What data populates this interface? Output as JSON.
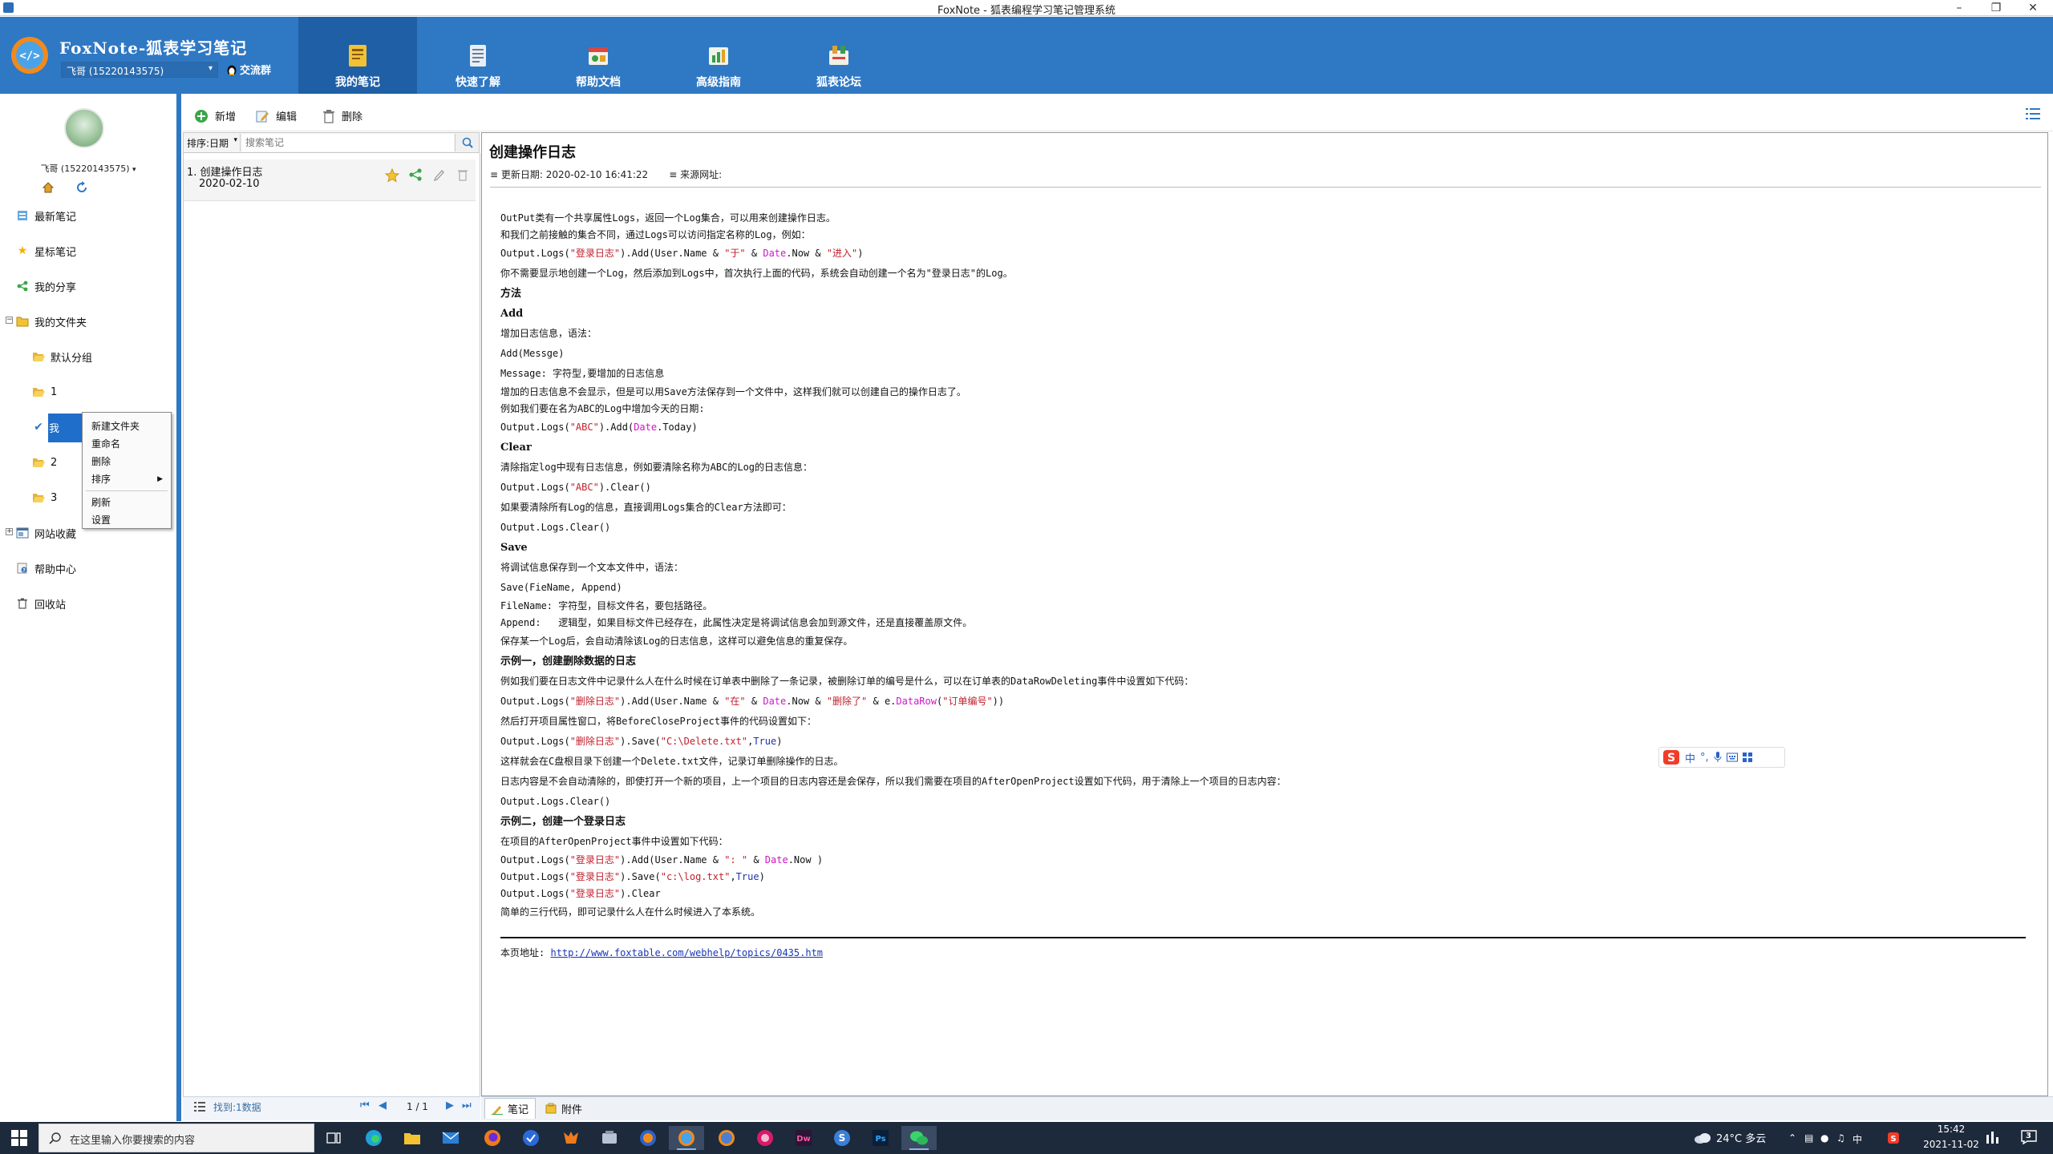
{
  "window": {
    "title": "FoxNote - 狐表编程学习笔记管理系统"
  },
  "header": {
    "app_title": "FoxNote-狐表学习笔记",
    "user": "飞哥 (15220143575)",
    "chat_group": "交流群",
    "tabs": [
      {
        "label": "我的笔记"
      },
      {
        "label": "快速了解"
      },
      {
        "label": "帮助文档"
      },
      {
        "label": "高级指南"
      },
      {
        "label": "狐表论坛"
      }
    ]
  },
  "sidebar": {
    "user_label": "飞哥 (15220143575)",
    "items": [
      {
        "label": "最新笔记"
      },
      {
        "label": "星标笔记"
      },
      {
        "label": "我的分享"
      },
      {
        "label": "我的文件夹"
      },
      {
        "label": "默认分组"
      },
      {
        "label": "1"
      },
      {
        "label": "我"
      },
      {
        "label": "2"
      },
      {
        "label": "3"
      },
      {
        "label": "网站收藏"
      },
      {
        "label": "帮助中心"
      },
      {
        "label": "回收站"
      }
    ]
  },
  "context_menu": {
    "items": [
      "新建文件夹",
      "重命名",
      "删除",
      "排序",
      "刷新",
      "设置"
    ]
  },
  "toolbar": {
    "new": "新增",
    "edit": "编辑",
    "delete": "删除"
  },
  "list": {
    "sort_label": "排序:日期",
    "search_placeholder": "搜索笔记",
    "items": [
      {
        "title": "1. 创建操作日志",
        "date": "2020-02-10"
      }
    ],
    "found": "找到:1数据",
    "page": "1 / 1"
  },
  "note": {
    "title": "创建操作日志",
    "updated": "更新日期: 2020-02-10 16:41:22",
    "source": "来源网址:",
    "page_url_label": "本页地址:",
    "page_url": "http://www.foxtable.com/webhelp/topics/0435.htm"
  },
  "content_tabs": [
    {
      "label": "笔记"
    },
    {
      "label": "附件"
    }
  ],
  "ime": {
    "label": "中"
  },
  "taskbar": {
    "search_placeholder": "在这里输入你要搜索的内容",
    "weather": "24°C 多云",
    "ime": "中",
    "time": "15:42",
    "date": "2021-11-02",
    "notifications": "3"
  }
}
